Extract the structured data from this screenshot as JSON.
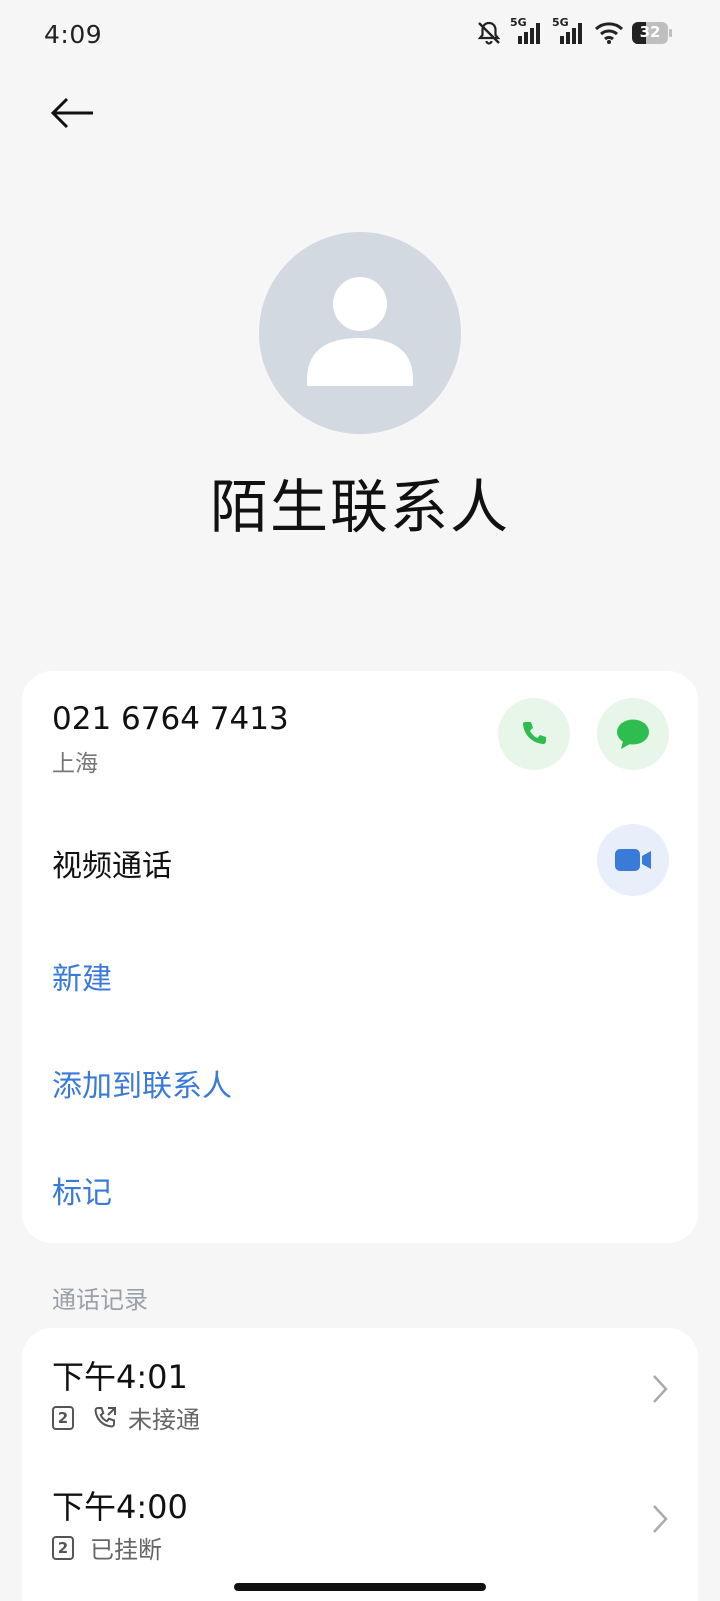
{
  "status_bar": {
    "time": "4:09",
    "battery": "32",
    "network_1": "5G",
    "network_2": "5G"
  },
  "contact": {
    "name": "陌生联系人"
  },
  "phone": {
    "number": "021 6764 7413",
    "location": "上海"
  },
  "video_call": {
    "label": "视频通话"
  },
  "actions": {
    "new": "新建",
    "add_to_contacts": "添加到联系人",
    "mark": "标记"
  },
  "call_log": {
    "section_title": "通话记录",
    "entries": [
      {
        "time": "下午4:01",
        "sim": "2",
        "status": "未接通"
      },
      {
        "time": "下午4:00",
        "sim": "2",
        "status": "已挂断"
      }
    ]
  },
  "colors": {
    "accent_blue": "#3a7ad8",
    "call_green": "#2ebd4e",
    "avatar_gray": "#d3d9e1"
  },
  "icons": {
    "back": "arrow-left-icon",
    "call": "phone-icon",
    "message": "message-icon",
    "video": "video-camera-icon",
    "chevron": "chevron-right-icon"
  }
}
